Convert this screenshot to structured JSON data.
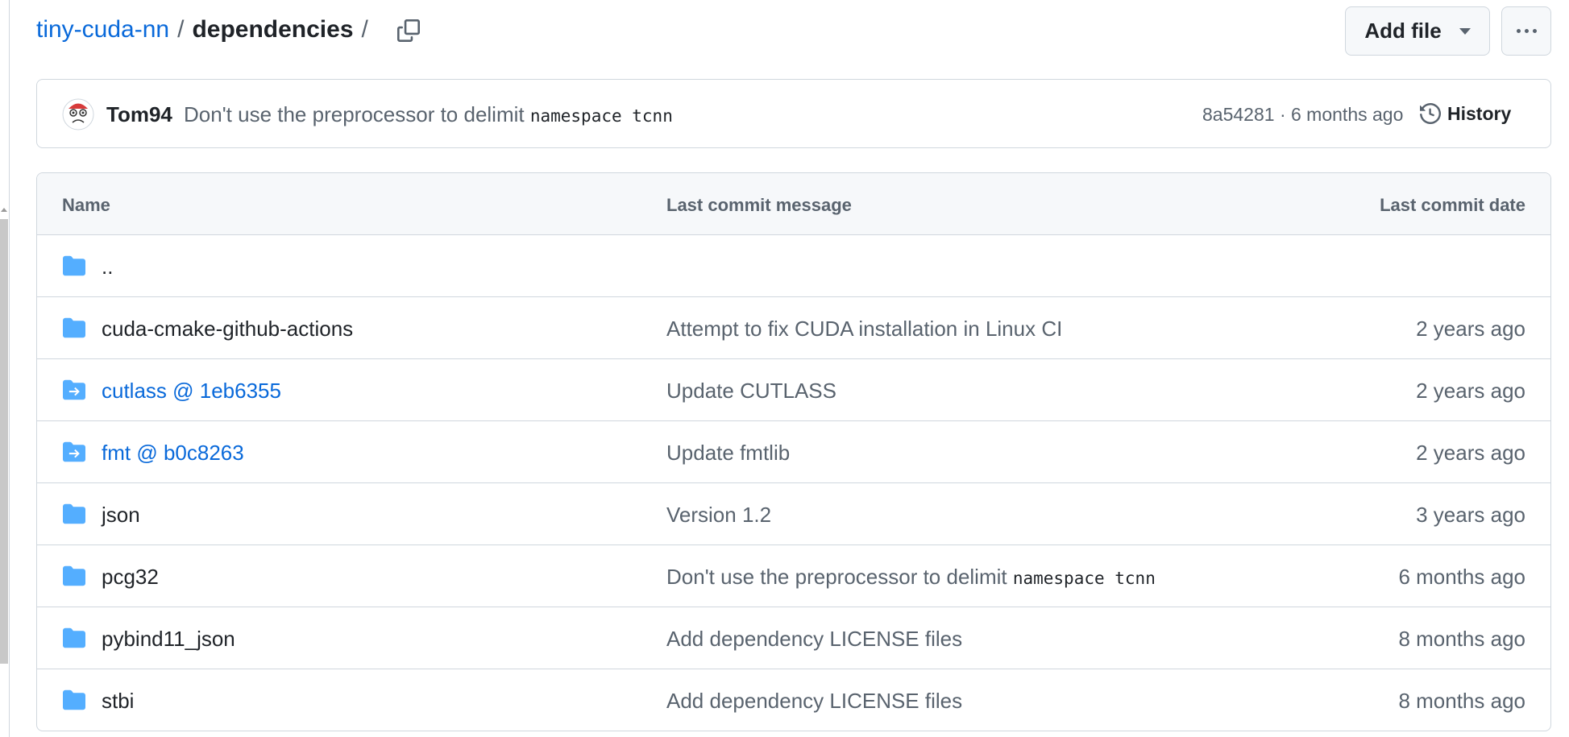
{
  "breadcrumb": {
    "repo": "tiny-cuda-nn",
    "separator": "/",
    "directory": "dependencies",
    "trailing": "/"
  },
  "toolbar": {
    "add_file_label": "Add file",
    "copy_icon": "copy-icon",
    "more_icon": "kebab-horizontal-icon"
  },
  "latest_commit": {
    "author": "Tom94",
    "message_text": "Don't use the preprocessor to delimit ",
    "message_code": "namespace tcnn",
    "hash": "8a54281",
    "dot": "·",
    "age": "6 months ago",
    "history_label": "History"
  },
  "table": {
    "headers": {
      "name": "Name",
      "message": "Last commit message",
      "date": "Last commit date"
    },
    "rows": [
      {
        "icon": "folder-icon",
        "name": "..",
        "message": "",
        "message_code": "",
        "date": "",
        "submodule": false
      },
      {
        "icon": "folder-icon",
        "name": "cuda-cmake-github-actions",
        "message": "Attempt to fix CUDA installation in Linux CI",
        "message_code": "",
        "date": "2 years ago",
        "submodule": false
      },
      {
        "icon": "submodule-icon",
        "name": "cutlass @ 1eb6355",
        "message": "Update CUTLASS",
        "message_code": "",
        "date": "2 years ago",
        "submodule": true
      },
      {
        "icon": "submodule-icon",
        "name": "fmt @ b0c8263",
        "message": "Update fmtlib",
        "message_code": "",
        "date": "2 years ago",
        "submodule": true
      },
      {
        "icon": "folder-icon",
        "name": "json",
        "message": "Version 1.2",
        "message_code": "",
        "date": "3 years ago",
        "submodule": false
      },
      {
        "icon": "folder-icon",
        "name": "pcg32",
        "message": "Don't use the preprocessor to delimit ",
        "message_code": "namespace tcnn",
        "date": "6 months ago",
        "submodule": false
      },
      {
        "icon": "folder-icon",
        "name": "pybind11_json",
        "message": "Add dependency LICENSE files",
        "message_code": "",
        "date": "8 months ago",
        "submodule": false
      },
      {
        "icon": "folder-icon",
        "name": "stbi",
        "message": "Add dependency LICENSE files",
        "message_code": "",
        "date": "8 months ago",
        "submodule": false
      }
    ]
  },
  "colors": {
    "link": "#0969da",
    "folder": "#54aeff",
    "muted": "#59636e",
    "border": "#d0d7de"
  }
}
